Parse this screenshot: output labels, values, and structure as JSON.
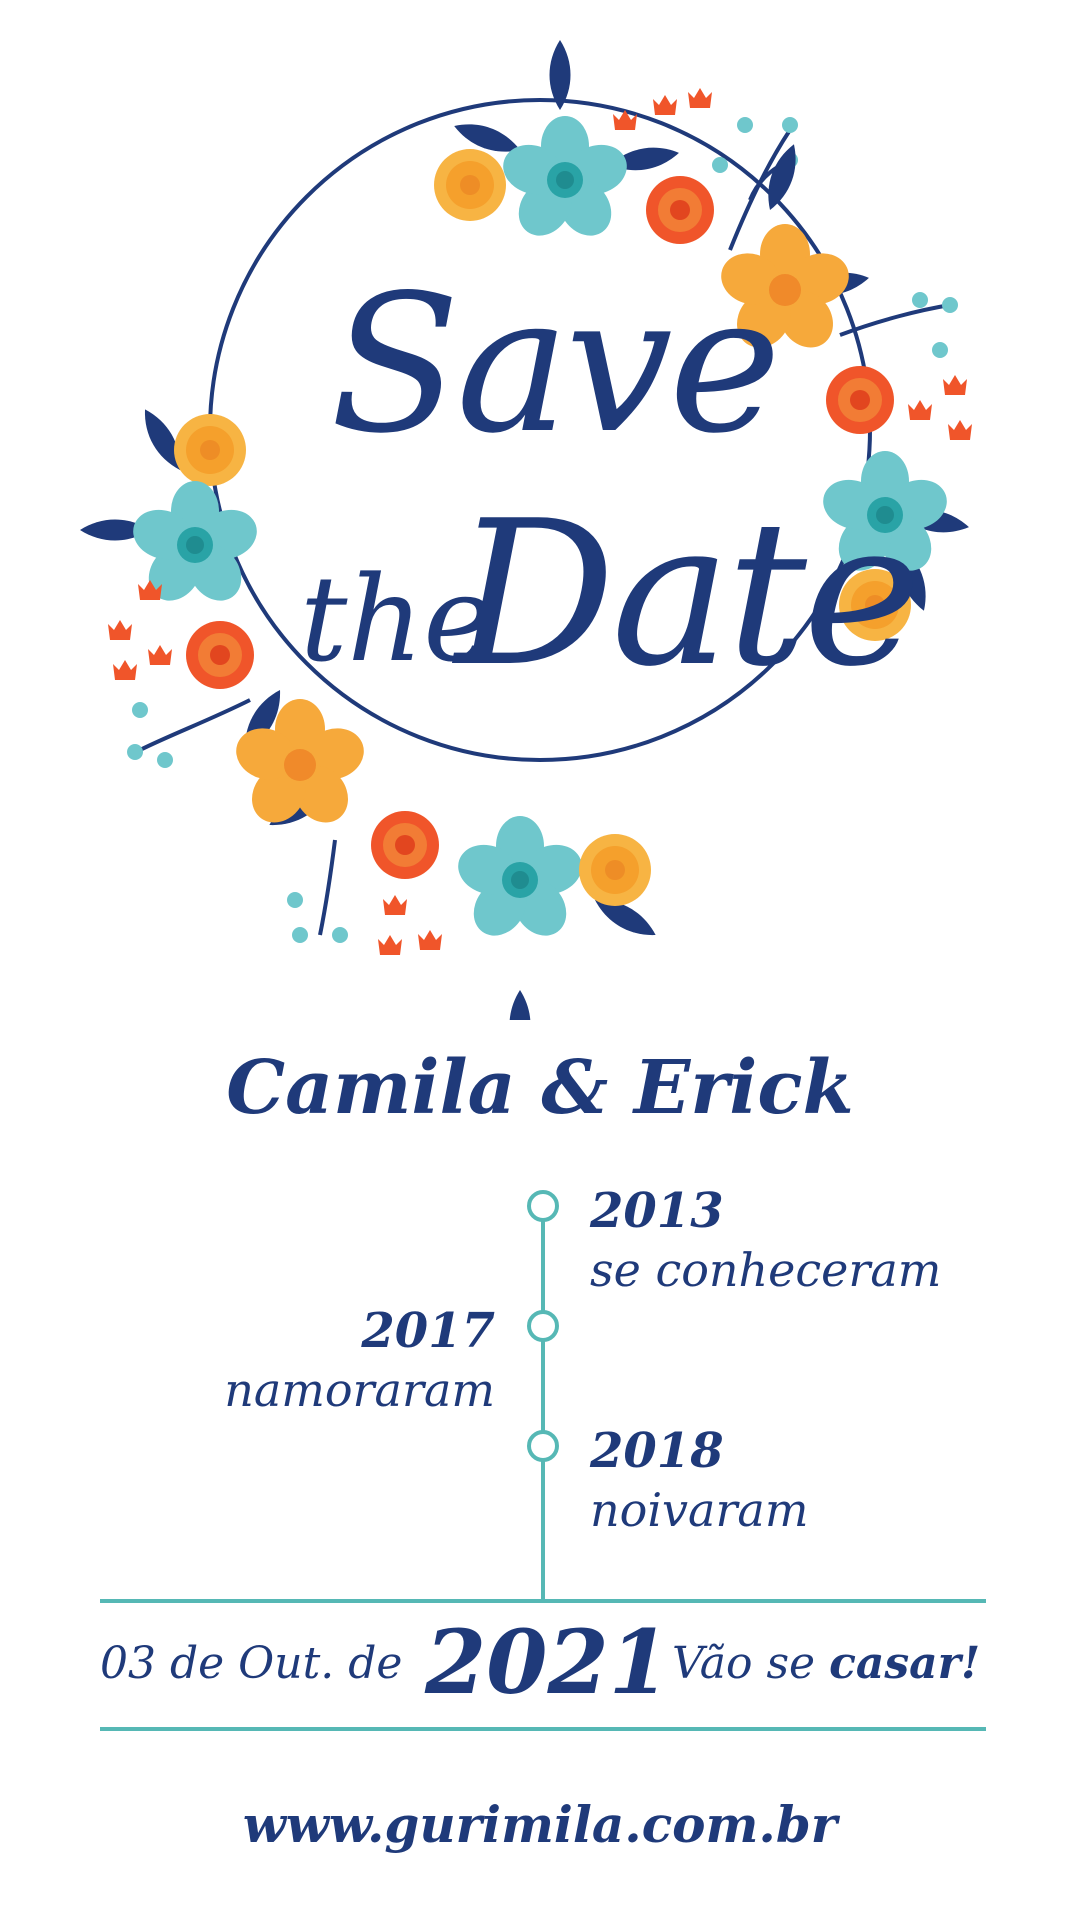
{
  "header": {
    "title_line1": "Save",
    "title_line2_small": "the",
    "title_line2_large": "Date"
  },
  "couple": {
    "names": "Camila & Erick"
  },
  "timeline": [
    {
      "year": "2013",
      "label": "se conheceram",
      "side": "right"
    },
    {
      "year": "2017",
      "label": "namoraram",
      "side": "left"
    },
    {
      "year": "2018",
      "label": "noivaram",
      "side": "right"
    }
  ],
  "wedding": {
    "date_prefix": "03 de Out. de",
    "year": "2021",
    "phrase": "Vão se",
    "phrase_bold": "casar!"
  },
  "website": "www.gurimila.com.br",
  "colors": {
    "navy": "#1f3a7a",
    "teal": "#56b8b5",
    "light_teal": "#6fc7cc",
    "orange": "#f0552a",
    "yellow_orange": "#f6a93b",
    "gold": "#f7b443"
  },
  "icons": [
    "flower-wreath",
    "timeline-dot-icon"
  ]
}
